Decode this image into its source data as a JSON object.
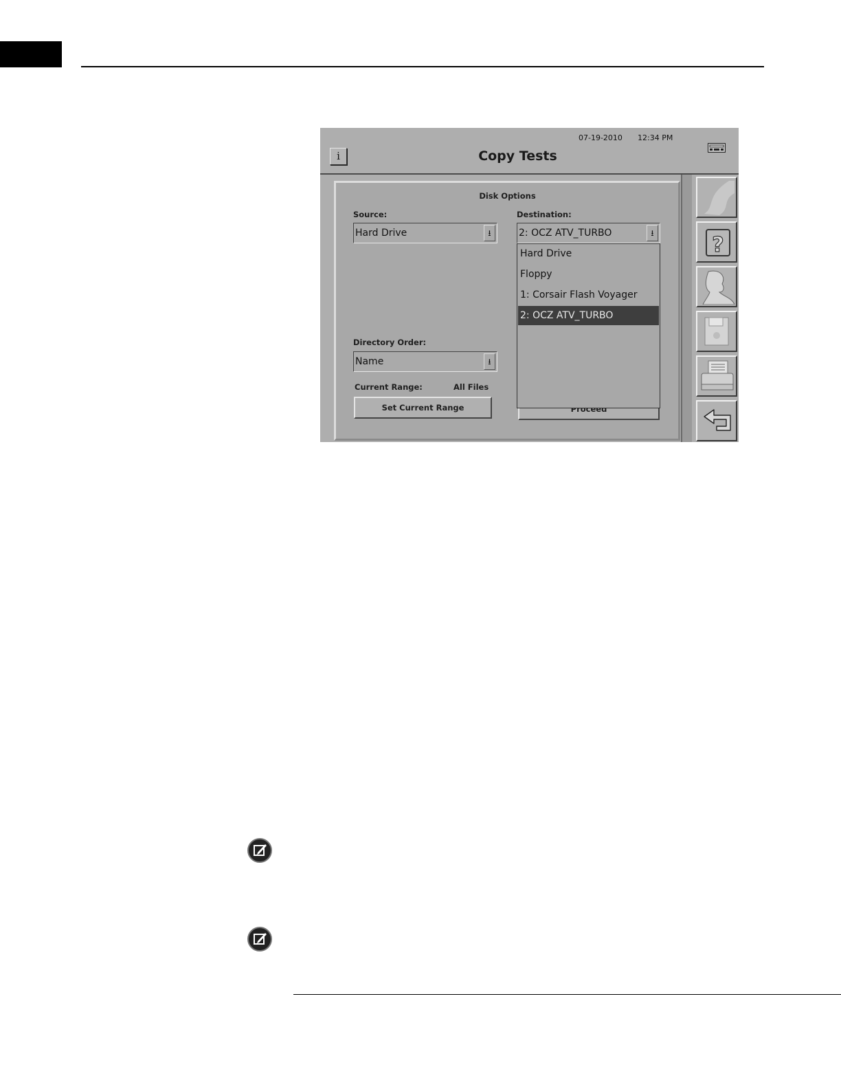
{
  "window": {
    "date": "07-19-2010",
    "time": "12:34 PM",
    "title": "Copy Tests",
    "info_button": "i"
  },
  "panel": {
    "heading": "Disk Options",
    "source_label": "Source:",
    "source_value": "Hard Drive",
    "destination_label": "Destination:",
    "destination_value": "2: OCZ ATV_TURBO",
    "destination_options": [
      "Hard Drive",
      "Floppy",
      "1: Corsair Flash Voyager",
      "2: OCZ ATV_TURBO"
    ],
    "destination_selected_index": 3,
    "directory_order_label": "Directory Order:",
    "directory_order_value": "Name",
    "current_range_label": "Current Range:",
    "current_range_value": "All Files",
    "set_range_button": "Set Current Range",
    "proceed_button": "Proceed",
    "dropdown_arrow": "⭳"
  },
  "sidebar": {
    "buttons": [
      "blank-swoosh-icon",
      "help-icon",
      "patient-profile-icon",
      "floppy-disk-icon",
      "printer-icon",
      "return-arrow-icon"
    ]
  }
}
